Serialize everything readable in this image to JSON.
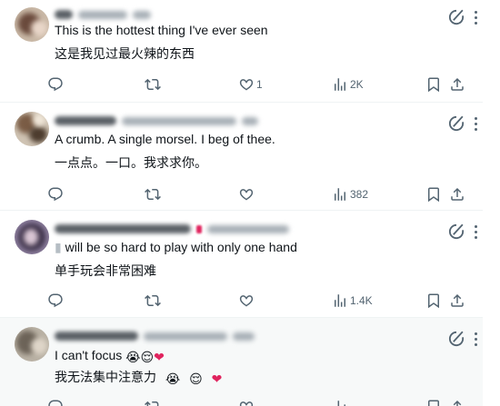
{
  "posts": [
    {
      "text": "This is the hottest thing I've ever seen",
      "translation": "这是我见过最火辣的东西",
      "counts": {
        "replies": "",
        "reposts": "",
        "likes": "1",
        "views": "2K"
      }
    },
    {
      "text": "A crumb. A single morsel. I beg of thee.",
      "translation": "一点点。一口。我求求你。",
      "counts": {
        "replies": "",
        "reposts": "",
        "likes": "",
        "views": "382"
      }
    },
    {
      "text": "will be so hard to play with only one hand",
      "translation": "单手玩会非常困难",
      "counts": {
        "replies": "",
        "reposts": "",
        "likes": "",
        "views": "1.4K"
      }
    },
    {
      "text": "I can't focus",
      "translation": "我无法集中注意力",
      "counts": {
        "replies": "",
        "reposts": "",
        "likes": "",
        "views": ""
      }
    }
  ],
  "emoji": {
    "crying": "😭",
    "relieved": "😌",
    "heart": "❤"
  },
  "icons": [
    "reply-icon",
    "repost-icon",
    "like-icon",
    "views-icon",
    "bookmark-icon",
    "share-icon",
    "grok-icon",
    "more-icon"
  ],
  "colors": {
    "icon": "#536471",
    "divider": "#eff3f4",
    "heart": "#f91880"
  }
}
